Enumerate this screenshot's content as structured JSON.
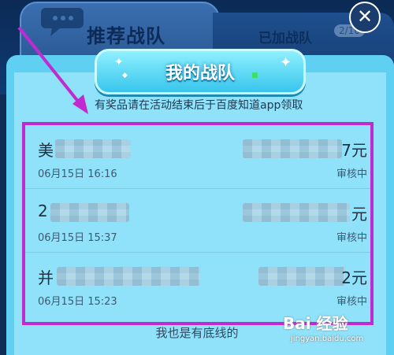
{
  "tabs": {
    "recommended": "推荐战队",
    "joined": "已加战队",
    "joined_count": "2/10"
  },
  "title": "我的战队",
  "notice": "有奖品请在活动结束后于百度知道app领取",
  "rows": [
    {
      "name": "美",
      "amount": "7元",
      "time": "06月15日 16:16",
      "status": "审核中"
    },
    {
      "name": "2",
      "amount": "元",
      "time": "06月15日 15:37",
      "status": "审核中"
    },
    {
      "name": "并",
      "amount": "2元",
      "time": "06月15日 15:23",
      "status": "审核中"
    }
  ],
  "footer": "我也是有底线的",
  "watermark": {
    "logo": "Bai 经验",
    "url": "jingyan.baidu.com"
  },
  "colors": {
    "highlight": "#c22ad1",
    "panel": "#5fcff2"
  }
}
